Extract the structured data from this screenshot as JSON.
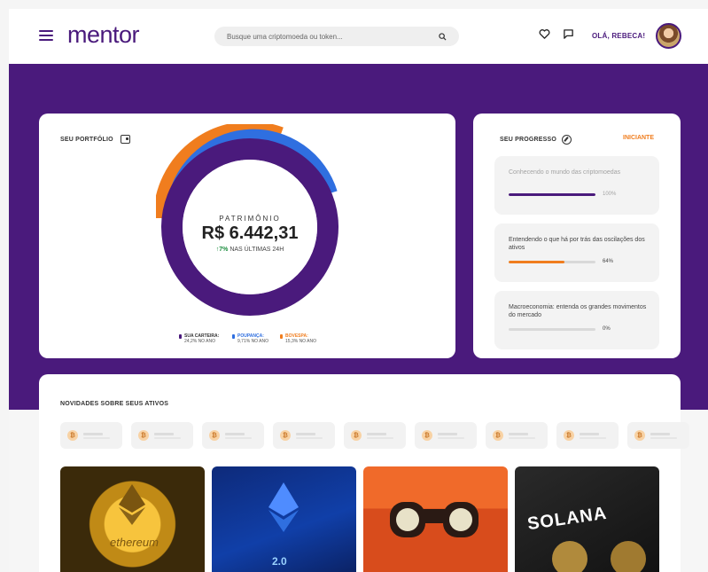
{
  "header": {
    "logo": "mentor",
    "search_placeholder": "Busque uma criptomoeda ou token...",
    "greeting": "OLÁ, REBECA!"
  },
  "portfolio": {
    "title": "SEU PORTFÓLIO",
    "patrimonio_label": "PATRIMÔNIO",
    "patrimonio_value": "R$ 6.442,31",
    "change_value": "7%",
    "change_label": "NAS ÚLTIMAS 24H",
    "legend": [
      {
        "name": "SUA CARTEIRA:",
        "sub": "24,2% NO ANO",
        "color": "#4a1a7c"
      },
      {
        "name": "POUPANÇA:",
        "sub": "9,71% NO ANO",
        "color": "#2f6fe0"
      },
      {
        "name": "BOVESPA:",
        "sub": "15,3% NO ANO",
        "color": "#f07d1e"
      }
    ]
  },
  "progress": {
    "title": "SEU PROGRESSO",
    "level": "INICIANTE",
    "items": [
      {
        "title": "Conhecendo o mundo das criptomoedas",
        "percent_label": "100%",
        "value": 1.0,
        "color": "#4a1a7c",
        "dim": true
      },
      {
        "title": "Entendendo o que há por trás das oscilações dos ativos",
        "percent_label": "64%",
        "value": 0.64,
        "color": "#f07d1e",
        "dim": false
      },
      {
        "title": "Macroeconomia: entenda os grandes movimentos do mercado",
        "percent_label": "0%",
        "value": 0.0,
        "color": "#4a1a7c",
        "dim": false
      }
    ]
  },
  "news": {
    "title": "NOVIDADES SOBRE SEUS ATIVOS",
    "chip_icon": "₿",
    "thumbs": [
      {
        "caption": "ethereum"
      },
      {
        "caption": "2.0"
      },
      {
        "caption": ""
      },
      {
        "caption": "SOLANA"
      }
    ]
  },
  "colors": {
    "brand": "#4a1a7c",
    "accent": "#f07d1e",
    "blue": "#2f6fe0",
    "positive": "#1b8d3e"
  },
  "icons": [
    "menu-icon",
    "search-icon",
    "heart-icon",
    "chat-icon",
    "wallet-icon",
    "compass-icon",
    "bitcoin-icon"
  ]
}
